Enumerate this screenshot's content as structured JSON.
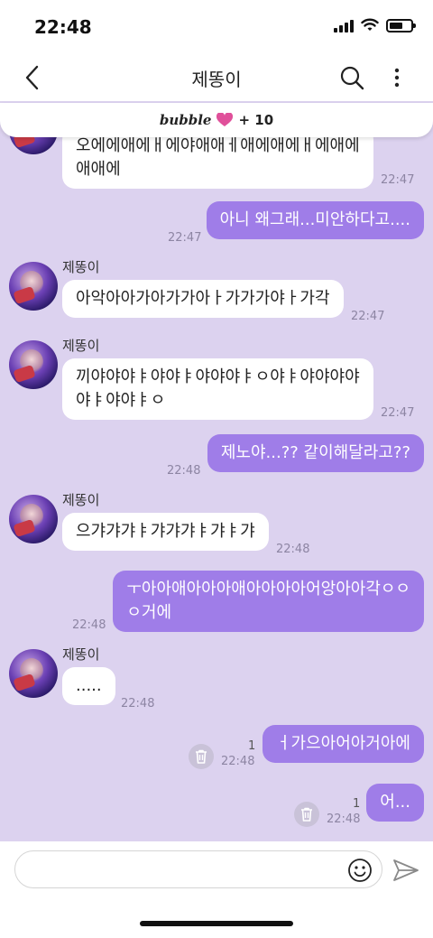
{
  "status_bar": {
    "time": "22:48"
  },
  "header": {
    "title": "제똥이"
  },
  "banner": {
    "brand": "bubble",
    "count": "+ 10"
  },
  "sender_name": "제똥이",
  "messages": [
    {
      "text": "오에에애에ㅐ에야애애ㅔ애에애에ㅐ에애에\n애애에",
      "time": "22:47"
    },
    {
      "text": "아니 왜그래...미안하다고....",
      "time": "22:47"
    },
    {
      "text": "아악아아가아가가아ㅏ가가가야ㅏ가각",
      "time": "22:47"
    },
    {
      "text": "끼야야야ㅑ야야ㅑ야야야ㅑㅇ야ㅑ야야야야\n야ㅑ야야ㅑㅇ",
      "time": "22:47"
    },
    {
      "text": "제노야...?? 같이해달라고??",
      "time": "22:48"
    },
    {
      "text": "으갸갸갸ㅑ갸갸갸ㅑ갸ㅑ갸",
      "time": "22:48"
    },
    {
      "text": "ㅜ아아애아아아애아아아아어앙아아각ㅇㅇ\nㅇ거에",
      "time": "22:48"
    },
    {
      "text": ".....",
      "time": "22:48"
    },
    {
      "text": "ㅓ가으아어아거아에",
      "time": "22:48",
      "unread": "1"
    },
    {
      "text": "어...",
      "time": "22:48",
      "unread": "1"
    }
  ],
  "input": {
    "placeholder": "",
    "value": ""
  },
  "icons": {
    "back": "chevron-left-icon",
    "search": "search-icon",
    "more": "more-vertical-icon",
    "heart": "heart-icon",
    "trash": "trash-icon",
    "emoji": "smiley-icon",
    "send": "send-icon"
  },
  "colors": {
    "chat_background": "#dcd2ef",
    "my_bubble": "#9f7de8",
    "their_bubble": "#ffffff",
    "heart": "#e0509a"
  }
}
